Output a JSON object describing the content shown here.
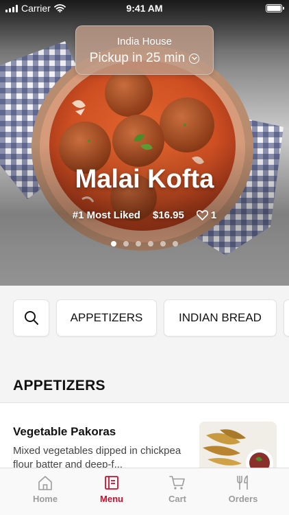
{
  "status_bar": {
    "carrier": "Carrier",
    "time": "9:41 AM"
  },
  "location": {
    "name": "India House",
    "pickup": "Pickup in 25 min"
  },
  "featured": {
    "title": "Malai Kofta",
    "badge": "#1 Most Liked",
    "price": "$16.95",
    "likes": "1",
    "slide_count": 6,
    "active_slide": 1
  },
  "search": {
    "icon": "search-icon"
  },
  "categories": [
    "APPETIZERS",
    "INDIAN BREAD"
  ],
  "section": {
    "title": "APPETIZERS"
  },
  "menu_items": [
    {
      "name": "Vegetable Pakoras",
      "description": "Mixed vegetables dipped in chickpea flour batter and deep-f..."
    }
  ],
  "tabs": [
    {
      "label": "Home",
      "icon": "home-icon"
    },
    {
      "label": "Menu",
      "icon": "menu-icon",
      "active": true
    },
    {
      "label": "Cart",
      "icon": "cart-icon"
    },
    {
      "label": "Orders",
      "icon": "fork-knife-icon"
    }
  ],
  "colors": {
    "accent": "#c8102e",
    "curry": "#d0532a",
    "inactive": "#9b9b9b"
  }
}
